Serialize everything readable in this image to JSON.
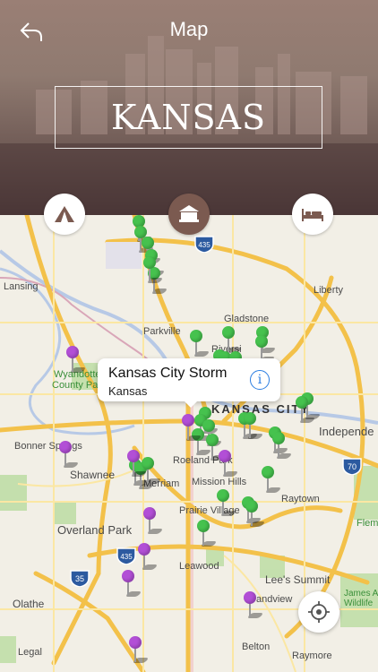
{
  "header": {
    "title": "Map",
    "state_name": "KANSAS",
    "back_icon": "back-arrow-icon"
  },
  "categories": [
    {
      "name": "camping",
      "icon": "tent-icon",
      "active": false
    },
    {
      "name": "hotels",
      "icon": "hotel-icon",
      "active": true
    },
    {
      "name": "lodging",
      "icon": "bed-icon",
      "active": false
    }
  ],
  "map": {
    "labels": {
      "lansing": "Lansing",
      "liberty": "Liberty",
      "gladstone": "Gladstone",
      "parkville": "Parkville",
      "riverside": "Riversi",
      "wyandotte": "Wyandotte",
      "county_park": "County Park",
      "kansas_city": "KANSAS CITY",
      "independence": "Independe",
      "bonner_springs": "Bonner Springs",
      "shawnee": "Shawnee",
      "merriam": "Merriam",
      "roeland_park": "Roeland Park",
      "mission_hills": "Mission Hills",
      "raytown": "Raytown",
      "prairie_village": "Prairie Village",
      "overland_park": "Overland Park",
      "leawood": "Leawood",
      "lees_summit": "Lee's Summit",
      "grandview": "andview",
      "olathe": "Olathe",
      "belton": "Belton",
      "raymore": "Raymore",
      "legal": "Legal",
      "flem": "Flemi",
      "james_a": "James A",
      "wildlife": "Wildlife"
    },
    "shields": {
      "i435_top": "435",
      "i435_bottom": "435",
      "i70": "70",
      "i35": "35"
    },
    "callout": {
      "title": "Kansas City Storm",
      "subtitle": "Kansas"
    },
    "colors": {
      "green_pin": "#46c24e",
      "purple_pin": "#b24fd6",
      "road": "#f5d76e",
      "highway": "#f3c14a"
    }
  }
}
